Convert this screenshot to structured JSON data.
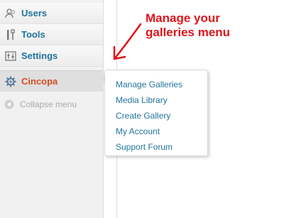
{
  "sidebar": {
    "items": [
      {
        "label": "Users",
        "icon": "users-icon"
      },
      {
        "label": "Tools",
        "icon": "tools-icon"
      },
      {
        "label": "Settings",
        "icon": "settings-icon"
      },
      {
        "label": "Cincopa",
        "icon": "cincopa-icon",
        "active": true
      }
    ],
    "collapse_label": "Collapse menu"
  },
  "submenu": {
    "items": [
      "Manage Galleries",
      "Media Library",
      "Create Gallery",
      "My Account",
      "Support Forum"
    ]
  },
  "annotation": {
    "line1": "Manage your",
    "line2": "galleries menu"
  },
  "colors": {
    "link": "#21759b",
    "active_label": "#d54e21",
    "annotation": "#e0141a"
  }
}
